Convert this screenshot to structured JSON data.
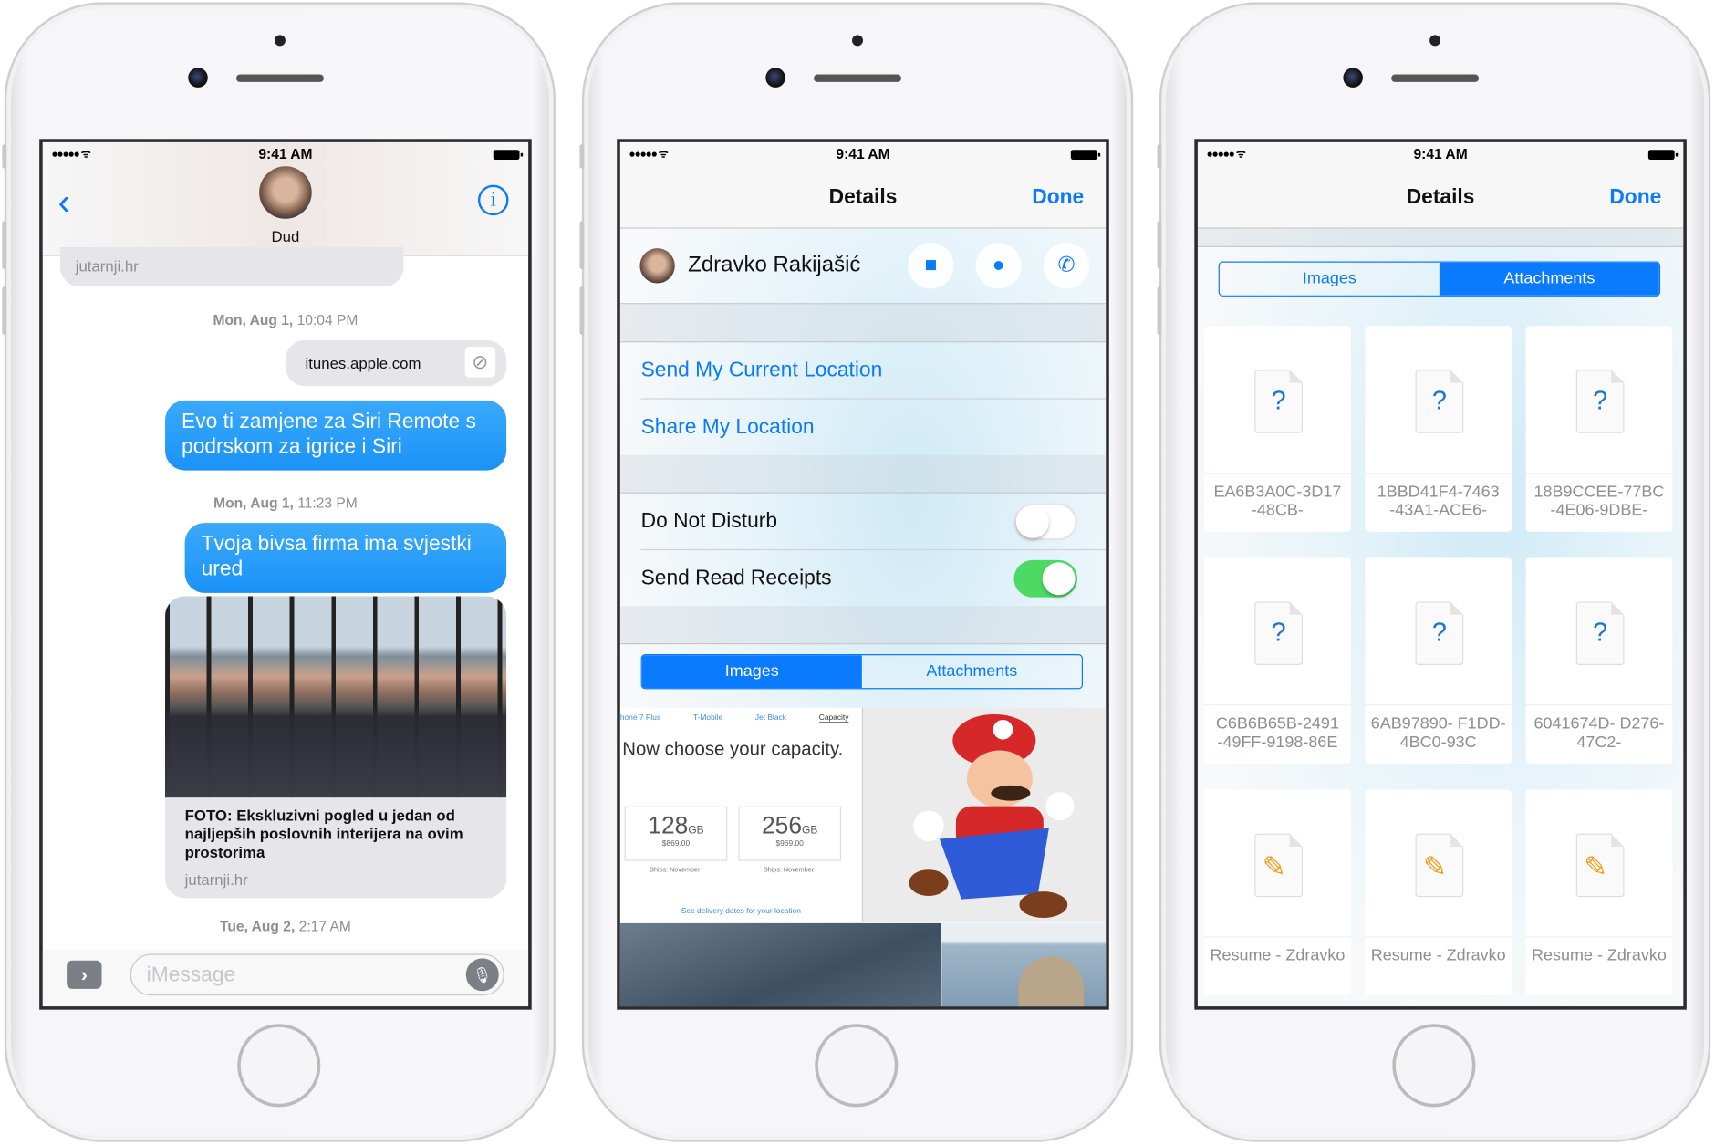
{
  "status_bar": {
    "signal": "●●●●● ᯤ",
    "time": "9:41 AM"
  },
  "conversation": {
    "contact_name": "Dud",
    "back_icon": "chevron-left-icon",
    "info_icon": "info-icon",
    "partial_source": "jutarnji.hr",
    "messages": [
      {
        "type": "timestamp",
        "day": "Mon, Aug 1,",
        "time": "10:04 PM"
      },
      {
        "type": "link",
        "text": "itunes.apple.com",
        "icon": "safari-compass-icon"
      },
      {
        "type": "outgoing",
        "text": "Evo ti zamjene za Siri Remote s podrskom za igrice i Siri"
      },
      {
        "type": "timestamp",
        "day": "Mon, Aug 1,",
        "time": "11:23 PM"
      },
      {
        "type": "outgoing",
        "text": "Tvoja bivsa firma ima svjestki ured"
      },
      {
        "type": "link_card",
        "title": "FOTO: Ekskluzivni pogled u jedan od najljepših poslovnih interijera na ovim prostorima",
        "source": "jutarnji.hr"
      },
      {
        "type": "timestamp",
        "day": "Tue, Aug 2,",
        "time": "2:17 AM"
      }
    ],
    "input_placeholder": "iMessage",
    "apps_icon": "chevron-right-icon",
    "mic_icon": "microphone-icon"
  },
  "details": {
    "title": "Details",
    "done_label": "Done",
    "contact_name": "Zdravko Rakijašić",
    "actions": [
      {
        "icon": "video-camera-icon",
        "glyph": "■"
      },
      {
        "icon": "message-bubble-icon",
        "glyph": "●"
      },
      {
        "icon": "phone-icon",
        "glyph": "✆"
      }
    ],
    "location_rows": [
      "Send My Current Location",
      "Share My Location"
    ],
    "toggles": [
      {
        "label": "Do Not Disturb",
        "on": false
      },
      {
        "label": "Send Read Receipts",
        "on": true
      }
    ],
    "segments": [
      "Images",
      "Attachments"
    ],
    "selected_segment": "Images",
    "images_thumb": {
      "tabs": [
        "hone 7 Plus",
        "T-Mobile",
        "Jet Black",
        "Capacity"
      ],
      "heading": "Now choose your capacity.",
      "options": [
        {
          "size": "128",
          "unit": "GB",
          "price": "$869.00",
          "ships": "Ships: November"
        },
        {
          "size": "256",
          "unit": "GB",
          "price": "$969.00",
          "ships": "Ships: November"
        }
      ],
      "link": "See delivery dates for your location"
    }
  },
  "attachments": {
    "title": "Details",
    "done_label": "Done",
    "segments": [
      "Images",
      "Attachments"
    ],
    "selected_segment": "Attachments",
    "files": [
      {
        "name": "EA6B3A0C-3D17 -48CB-",
        "icon": "unknown-file-icon"
      },
      {
        "name": "1BBD41F4-7463 -43A1-ACE6-",
        "icon": "unknown-file-icon"
      },
      {
        "name": "18B9CCEE-77BC -4E06-9DBE-",
        "icon": "unknown-file-icon"
      },
      {
        "name": "C6B6B65B-2491 -49FF-9198-86E",
        "icon": "unknown-file-icon"
      },
      {
        "name": "6AB97890- F1DD-4BC0-93C",
        "icon": "unknown-file-icon"
      },
      {
        "name": "6041674D- D276-47C2-",
        "icon": "unknown-file-icon"
      },
      {
        "name": "Resume - Zdravko",
        "icon": "pages-document-icon"
      },
      {
        "name": "Resume - Zdravko",
        "icon": "pages-document-icon"
      },
      {
        "name": "Resume - Zdravko",
        "icon": "pages-document-icon"
      }
    ]
  },
  "colors": {
    "accent": "#0a7aff",
    "outgoing_bubble": "#1e9bfa",
    "toggle_on": "#4cd964",
    "pages_orange": "#f29b13"
  }
}
